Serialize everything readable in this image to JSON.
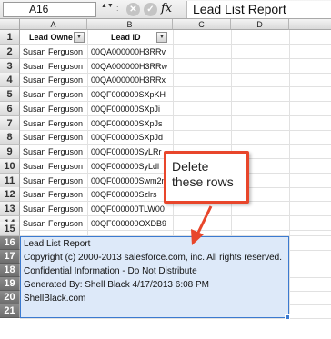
{
  "formula_bar": {
    "cell_ref": "A16",
    "stepper": "▲▼",
    "separator": ":",
    "cancel_glyph": "✕",
    "confirm_glyph": "✓",
    "fx_label": "fx",
    "formula_text": "Lead List Report"
  },
  "columns": [
    "A",
    "B",
    "C",
    "D"
  ],
  "row_numbers": [
    "1",
    "2",
    "3",
    "4",
    "5",
    "6",
    "7",
    "8",
    "9",
    "10",
    "11",
    "12",
    "13",
    "14",
    "15",
    "16",
    "17",
    "18",
    "19",
    "20",
    "21"
  ],
  "headers": {
    "lead_owner": "Lead Owne",
    "lead_id": "Lead ID",
    "dropdown_glyph": "▼"
  },
  "rows": [
    {
      "owner": "Susan Ferguson",
      "id": "00QA000000H3RRv"
    },
    {
      "owner": "Susan Ferguson",
      "id": "00QA000000H3RRw"
    },
    {
      "owner": "Susan Ferguson",
      "id": "00QA000000H3RRx"
    },
    {
      "owner": "Susan Ferguson",
      "id": "00QF000000SXpKH"
    },
    {
      "owner": "Susan Ferguson",
      "id": "00QF000000SXpJi"
    },
    {
      "owner": "Susan Ferguson",
      "id": "00QF000000SXpJs"
    },
    {
      "owner": "Susan Ferguson",
      "id": "00QF000000SXpJd"
    },
    {
      "owner": "Susan Ferguson",
      "id": "00QF000000SyLRr"
    },
    {
      "owner": "Susan Ferguson",
      "id": "00QF000000SyLdl"
    },
    {
      "owner": "Susan Ferguson",
      "id": "00QF000000Swm2n"
    },
    {
      "owner": "Susan Ferguson",
      "id": "00QF000000Szlrs"
    },
    {
      "owner": "Susan Ferguson",
      "id": "00QF000000TLW00"
    },
    {
      "owner": "Susan Ferguson",
      "id": "00QF000000OXDB9"
    }
  ],
  "footer": [
    "Lead List Report",
    "Copyright (c) 2000-2013 salesforce.com, inc. All rights reserved.",
    "Confidential Information - Do Not Distribute",
    "Generated By: Shell Black 4/17/2013 6:08 PM",
    "ShellBlack.com",
    ""
  ],
  "callout": {
    "text": "Delete these rows"
  },
  "colors": {
    "selection_fill": "#dde9f9",
    "selection_border": "#3b7ad0",
    "callout_red": "#e8462b"
  }
}
